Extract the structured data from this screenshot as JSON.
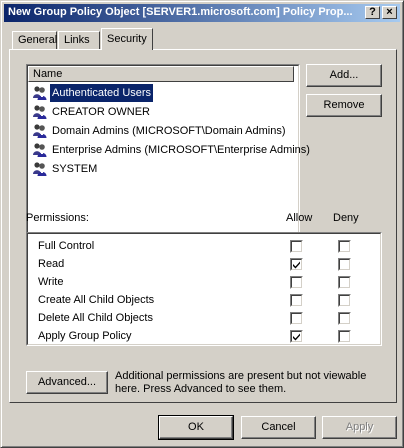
{
  "window": {
    "title": "New Group Policy Object [SERVER1.microsoft.com] Policy Prop...",
    "help_btn": "?",
    "close_btn": "×"
  },
  "tabs": [
    {
      "label": "General",
      "active": false
    },
    {
      "label": "Links",
      "active": false
    },
    {
      "label": "Security",
      "active": true
    }
  ],
  "users": {
    "column_header": "Name",
    "items": [
      {
        "label": "Authenticated Users",
        "icon": "users-group-icon",
        "selected": true
      },
      {
        "label": "CREATOR OWNER",
        "icon": "users-group-icon",
        "selected": false
      },
      {
        "label": "Domain Admins (MICROSOFT\\Domain Admins)",
        "icon": "users-group-icon",
        "selected": false
      },
      {
        "label": "Enterprise Admins (MICROSOFT\\Enterprise Admins)",
        "icon": "users-group-icon",
        "selected": false
      },
      {
        "label": "SYSTEM",
        "icon": "users-group-icon",
        "selected": false
      }
    ],
    "add_label": "Add...",
    "remove_label": "Remove"
  },
  "permissions": {
    "label": "Permissions:",
    "allow_header": "Allow",
    "deny_header": "Deny",
    "rows": [
      {
        "label": "Full Control",
        "allow": false,
        "deny": false
      },
      {
        "label": "Read",
        "allow": true,
        "deny": false
      },
      {
        "label": "Write",
        "allow": false,
        "deny": false
      },
      {
        "label": "Create All Child Objects",
        "allow": false,
        "deny": false
      },
      {
        "label": "Delete All Child Objects",
        "allow": false,
        "deny": false
      },
      {
        "label": "Apply Group Policy",
        "allow": true,
        "deny": false
      }
    ]
  },
  "advanced": {
    "button_label": "Advanced...",
    "note": "Additional permissions are present but not viewable here. Press Advanced to see them."
  },
  "footer": {
    "ok_label": "OK",
    "cancel_label": "Cancel",
    "apply_label": "Apply"
  },
  "colors": {
    "title_start": "#0a246a",
    "title_end": "#a6caf0",
    "face": "#d4d0c8",
    "selection": "#0a246a"
  }
}
